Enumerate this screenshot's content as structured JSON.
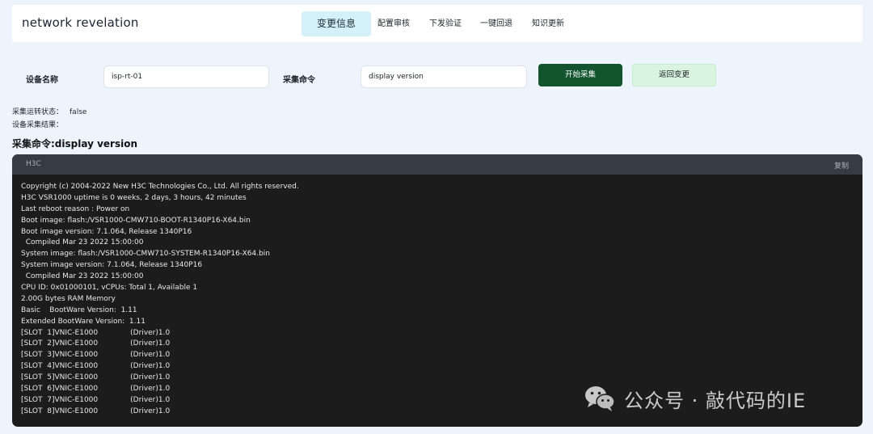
{
  "header": {
    "brand": "network revelation",
    "nav": [
      {
        "label": "变更信息",
        "active": true
      },
      {
        "label": "配置审核",
        "active": false
      },
      {
        "label": "下发验证",
        "active": false
      },
      {
        "label": "一键回退",
        "active": false
      },
      {
        "label": "知识更新",
        "active": false
      }
    ]
  },
  "form": {
    "device_label": "设备名称",
    "device_value": "isp-rt-01",
    "command_label": "采集命令",
    "command_value": "display version",
    "start_button": "开始采集",
    "back_button": "返回变更"
  },
  "status": {
    "run_state_label": "采集运转状态：",
    "run_state_value": "false",
    "result_label": "设备采集结果："
  },
  "section_title": "采集命令:display version",
  "code": {
    "language": "H3C",
    "copy_label": "复制",
    "lines": [
      "Copyright (c) 2004-2022 New H3C Technologies Co., Ltd. All rights reserved.",
      "H3C VSR1000 uptime is 0 weeks, 2 days, 3 hours, 42 minutes",
      "Last reboot reason : Power on",
      "Boot image: flash:/VSR1000-CMW710-BOOT-R1340P16-X64.bin",
      "Boot image version: 7.1.064, Release 1340P16",
      "  Compiled Mar 23 2022 15:00:00",
      "System image: flash:/VSR1000-CMW710-SYSTEM-R1340P16-X64.bin",
      "System image version: 7.1.064, Release 1340P16",
      "  Compiled Mar 23 2022 15:00:00",
      "CPU ID: 0x01000101, vCPUs: Total 1, Available 1",
      "2.00G bytes RAM Memory",
      "Basic    BootWare Version:  1.11",
      "Extended BootWare Version:  1.11",
      "[SLOT  1]VNIC-E1000              (Driver)1.0",
      "[SLOT  2]VNIC-E1000              (Driver)1.0",
      "[SLOT  3]VNIC-E1000              (Driver)1.0",
      "[SLOT  4]VNIC-E1000              (Driver)1.0",
      "[SLOT  5]VNIC-E1000              (Driver)1.0",
      "[SLOT  6]VNIC-E1000              (Driver)1.0",
      "[SLOT  7]VNIC-E1000              (Driver)1.0",
      "[SLOT  8]VNIC-E1000              (Driver)1.0"
    ]
  },
  "watermark": {
    "icon": "wechat-icon",
    "text": "公众号 · 敲代码的IE"
  },
  "colors": {
    "page_bg": "#edf4fc",
    "active_tab_bg": "#d4f1f9",
    "primary_button": "#11542e",
    "secondary_button": "#d9f5e0",
    "code_bg": "#1c1c1c",
    "code_header_bg": "#363b44"
  }
}
